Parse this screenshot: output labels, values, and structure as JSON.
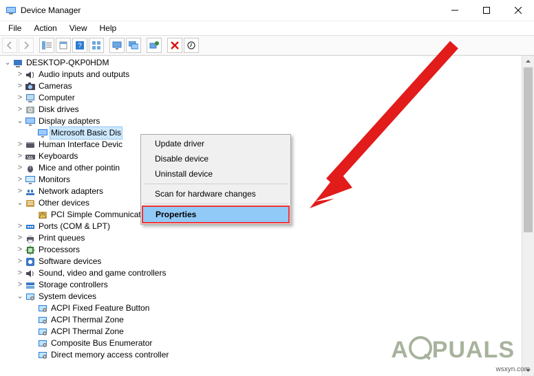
{
  "window": {
    "title": "Device Manager"
  },
  "menu": {
    "file": "File",
    "action": "Action",
    "view": "View",
    "help": "Help"
  },
  "toolbar_icons": {
    "back": "back-icon",
    "forward": "forward-icon",
    "show_hide": "show-hide-icon",
    "properties": "properties-icon",
    "help": "help-icon",
    "grid": "grid-icon",
    "monitor": "monitor-icon",
    "monitor_stack": "monitor-stack-icon",
    "scan": "scan-icon",
    "delete": "delete-icon",
    "update": "update-icon"
  },
  "tree": {
    "root": "DESKTOP-QKP0HDM",
    "items": [
      {
        "label": "Audio inputs and outputs",
        "icon": "audio"
      },
      {
        "label": "Cameras",
        "icon": "camera"
      },
      {
        "label": "Computer",
        "icon": "computer"
      },
      {
        "label": "Disk drives",
        "icon": "disk"
      },
      {
        "label": "Display adapters",
        "icon": "display",
        "expanded": true,
        "children": [
          {
            "label": "Microsoft Basic Dis",
            "icon": "display",
            "selected": true
          }
        ]
      },
      {
        "label": "Human Interface Devic",
        "icon": "hid"
      },
      {
        "label": "Keyboards",
        "icon": "keyboard"
      },
      {
        "label": "Mice and other pointin",
        "icon": "mouse"
      },
      {
        "label": "Monitors",
        "icon": "monitor"
      },
      {
        "label": "Network adapters",
        "icon": "network"
      },
      {
        "label": "Other devices",
        "icon": "other",
        "expanded": true,
        "children": [
          {
            "label": "PCI Simple Communications Controller",
            "icon": "warning"
          }
        ]
      },
      {
        "label": "Ports (COM & LPT)",
        "icon": "port"
      },
      {
        "label": "Print queues",
        "icon": "printer"
      },
      {
        "label": "Processors",
        "icon": "cpu"
      },
      {
        "label": "Software devices",
        "icon": "software"
      },
      {
        "label": "Sound, video and game controllers",
        "icon": "sound"
      },
      {
        "label": "Storage controllers",
        "icon": "storage"
      },
      {
        "label": "System devices",
        "icon": "system",
        "expanded": true,
        "children": [
          {
            "label": "ACPI Fixed Feature Button",
            "icon": "system"
          },
          {
            "label": "ACPI Thermal Zone",
            "icon": "system"
          },
          {
            "label": "ACPI Thermal Zone",
            "icon": "system"
          },
          {
            "label": "Composite Bus Enumerator",
            "icon": "system"
          },
          {
            "label": "Direct memory access controller",
            "icon": "system"
          }
        ]
      }
    ]
  },
  "context_menu": {
    "update_driver": "Update driver",
    "disable_device": "Disable device",
    "uninstall_device": "Uninstall device",
    "scan_hardware": "Scan for hardware changes",
    "properties": "Properties"
  },
  "watermark": {
    "logo_text_pre": "A",
    "logo_text_post": "PUALS",
    "url": "wsxyn.com"
  }
}
